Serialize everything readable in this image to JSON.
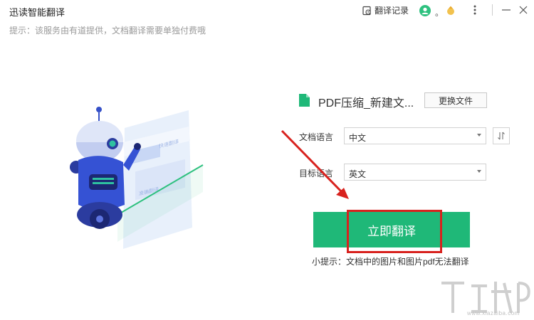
{
  "app": {
    "title": "迅读智能翻译",
    "subtitle": "提示：该服务由有道提供，文档翻译需要单独付费哦"
  },
  "header": {
    "history_label": "翻译记录",
    "user_dot": "。",
    "icons": [
      "history-icon",
      "user-icon",
      "vip-icon",
      "menu-icon",
      "minimize-icon",
      "close-icon"
    ]
  },
  "file": {
    "name": "PDF压缩_新建文...",
    "change_label": "更换文件",
    "icon": "file-icon"
  },
  "form": {
    "doc_lang_label": "文档语言",
    "doc_lang_value": "中文",
    "target_lang_label": "目标语言",
    "target_lang_value": "英文",
    "swap_icon": "swap-icon"
  },
  "action": {
    "translate_label": "立即翻译",
    "tip": "小提示：文档中的图片和图片pdf无法翻译"
  },
  "illustration": {
    "label_1": "快速翻译",
    "label_2": "准确翻译"
  },
  "watermark": {
    "text": "www.xiazaiba.com"
  },
  "colors": {
    "accent": "#1fb878",
    "highlight": "#d8221e",
    "user_green": "#2ec17f"
  }
}
